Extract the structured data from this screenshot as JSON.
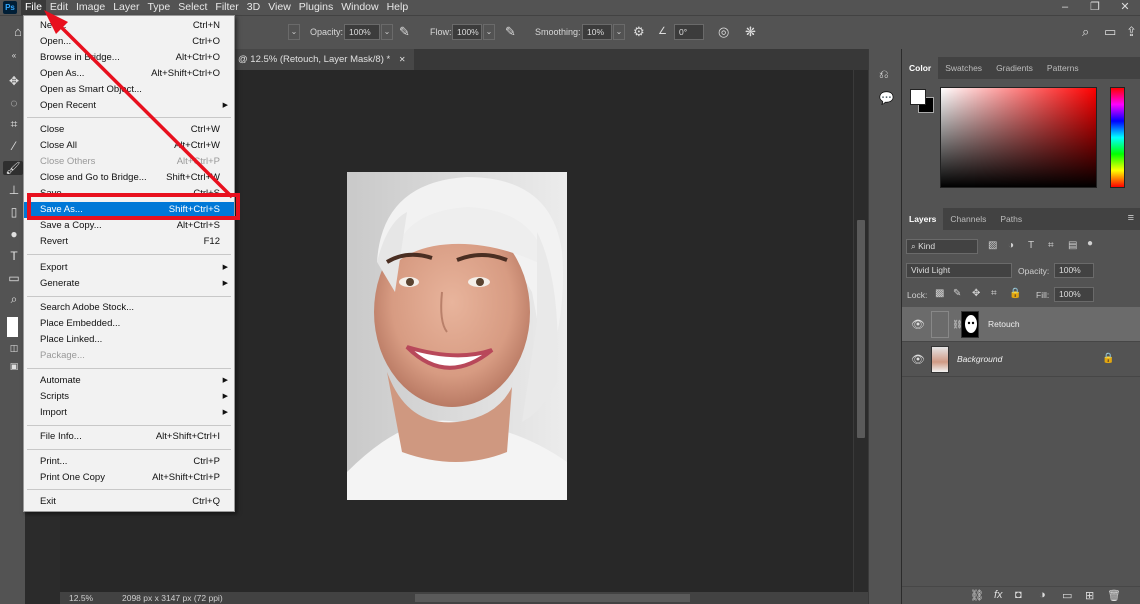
{
  "menubar": {
    "logo": "Ps",
    "items": [
      "File",
      "Edit",
      "Image",
      "Layer",
      "Type",
      "Select",
      "Filter",
      "3D",
      "View",
      "Plugins",
      "Window",
      "Help"
    ]
  },
  "options": {
    "opacity_label": "Opacity:",
    "opacity_value": "100%",
    "flow_label": "Flow:",
    "flow_value": "100%",
    "smoothing_label": "Smoothing:",
    "smoothing_value": "10%",
    "angle_value": "0°"
  },
  "document": {
    "tab_title": "@ 12.5% (Retouch, Layer Mask/8) *",
    "zoom": "12.5%",
    "doc_info": "2098 px x 3147 px (72 ppi)"
  },
  "color_panel": {
    "tabs": [
      "Color",
      "Swatches",
      "Gradients",
      "Patterns"
    ],
    "accent": "#ff0000"
  },
  "layers_panel": {
    "tabs": [
      "Layers",
      "Channels",
      "Paths"
    ],
    "filter_kind": "Kind",
    "blend_mode": "Vivid Light",
    "opacity_label": "Opacity:",
    "opacity_value": "100%",
    "lock_label": "Lock:",
    "fill_label": "Fill:",
    "fill_value": "100%",
    "layers": [
      {
        "name": "Retouch"
      },
      {
        "name": "Background"
      }
    ]
  },
  "file_menu": {
    "items": [
      {
        "label": "New...",
        "shortcut": "Ctrl+N"
      },
      {
        "label": "Open...",
        "shortcut": "Ctrl+O"
      },
      {
        "label": "Browse in Bridge...",
        "shortcut": "Alt+Ctrl+O"
      },
      {
        "label": "Open As...",
        "shortcut": "Alt+Shift+Ctrl+O"
      },
      {
        "label": "Open as Smart Object...",
        "shortcut": ""
      },
      {
        "label": "Open Recent",
        "shortcut": ""
      },
      {
        "label": "Close",
        "shortcut": "Ctrl+W"
      },
      {
        "label": "Close All",
        "shortcut": "Alt+Ctrl+W"
      },
      {
        "label": "Close Others",
        "shortcut": "Alt+Ctrl+P"
      },
      {
        "label": "Close and Go to Bridge...",
        "shortcut": "Shift+Ctrl+W"
      },
      {
        "label": "Save",
        "shortcut": "Ctrl+S"
      },
      {
        "label": "Save As...",
        "shortcut": "Shift+Ctrl+S"
      },
      {
        "label": "Save a Copy...",
        "shortcut": "Alt+Ctrl+S"
      },
      {
        "label": "Revert",
        "shortcut": "F12"
      },
      {
        "label": "Export",
        "shortcut": ""
      },
      {
        "label": "Generate",
        "shortcut": ""
      },
      {
        "label": "Search Adobe Stock...",
        "shortcut": ""
      },
      {
        "label": "Place Embedded...",
        "shortcut": ""
      },
      {
        "label": "Place Linked...",
        "shortcut": ""
      },
      {
        "label": "Package...",
        "shortcut": ""
      },
      {
        "label": "Automate",
        "shortcut": ""
      },
      {
        "label": "Scripts",
        "shortcut": ""
      },
      {
        "label": "Import",
        "shortcut": ""
      },
      {
        "label": "File Info...",
        "shortcut": "Alt+Shift+Ctrl+I"
      },
      {
        "label": "Print...",
        "shortcut": "Ctrl+P"
      },
      {
        "label": "Print One Copy",
        "shortcut": "Alt+Shift+Ctrl+P"
      },
      {
        "label": "Exit",
        "shortcut": "Ctrl+Q"
      }
    ]
  },
  "annotation": {
    "color": "#e8101e"
  }
}
